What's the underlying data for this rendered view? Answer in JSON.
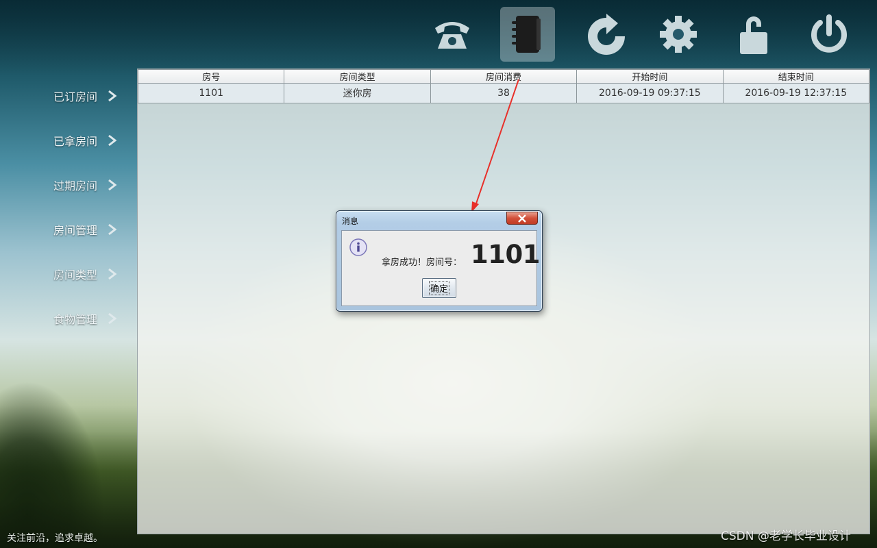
{
  "toolbar": {
    "icons": [
      "phone-icon",
      "notebook-icon",
      "refresh-icon",
      "gear-icon",
      "unlock-icon",
      "power-icon"
    ],
    "active": "notebook-icon"
  },
  "sidebar": {
    "items": [
      {
        "label": "已订房间"
      },
      {
        "label": "已拿房间"
      },
      {
        "label": "过期房间"
      },
      {
        "label": "房间管理"
      },
      {
        "label": "房间类型"
      },
      {
        "label": "食物管理"
      }
    ]
  },
  "table": {
    "headers": [
      "房号",
      "房间类型",
      "房间消费",
      "开始时间",
      "结束时间"
    ],
    "rows": [
      [
        "1101",
        "迷你房",
        "38",
        "2016-09-19 09:37:15",
        "2016-09-19 12:37:15"
      ]
    ]
  },
  "dialog": {
    "title": "消息",
    "message": "拿房成功！房间号：",
    "room_number": "1101",
    "ok_label": "确定"
  },
  "footer": {
    "slogan": "关注前沿，追求卓越。",
    "watermark": "CSDN @老学长毕业设计"
  },
  "colors": {
    "arrow": "#e8302a",
    "close_button": "#d2503a"
  }
}
